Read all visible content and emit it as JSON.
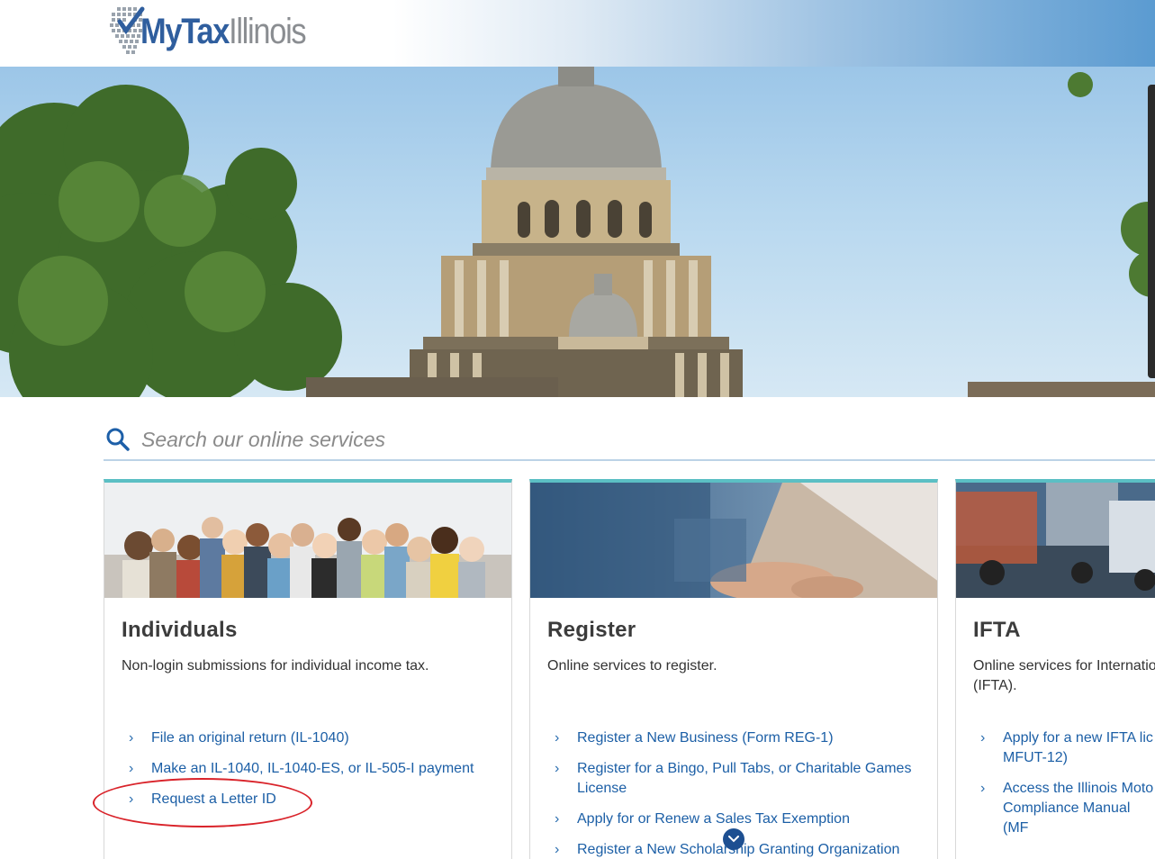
{
  "header": {
    "logo_my": "MyTax",
    "logo_il": "Illinois",
    "brand_color": "#2f5e9e"
  },
  "search": {
    "placeholder": "Search our online services",
    "icon": "search-icon"
  },
  "cards": [
    {
      "title": "Individuals",
      "description": "Non-login submissions for individual income tax.",
      "image": "group-of-people-photo",
      "links": [
        {
          "label": "File an original return (IL-1040)"
        },
        {
          "label": "Make an IL-1040, IL-1040-ES, or IL-505-I payment"
        },
        {
          "label": "Request a Letter ID"
        }
      ]
    },
    {
      "title": "Register",
      "description": "Online services to register.",
      "image": "person-typing-laptop-photo",
      "links": [
        {
          "label": "Register a New Business (Form REG-1)"
        },
        {
          "label": "Register for a Bingo, Pull Tabs, or Charitable Games License"
        },
        {
          "label": "Apply for or Renew a Sales Tax Exemption"
        },
        {
          "label": "Register a New Scholarship Granting Organization"
        }
      ]
    },
    {
      "title": "IFTA",
      "description": "Online services for Internatio (IFTA).",
      "image": "trucks-highway-photo",
      "links": [
        {
          "label": "Apply for a new IFTA lic MFUT-12)"
        },
        {
          "label": "Access the Illinois Moto Compliance Manual (MF"
        }
      ]
    }
  ],
  "colors": {
    "accent_teal": "#5bbfc4",
    "link_blue": "#1c5fa6",
    "highlight_red": "#d9232a"
  }
}
